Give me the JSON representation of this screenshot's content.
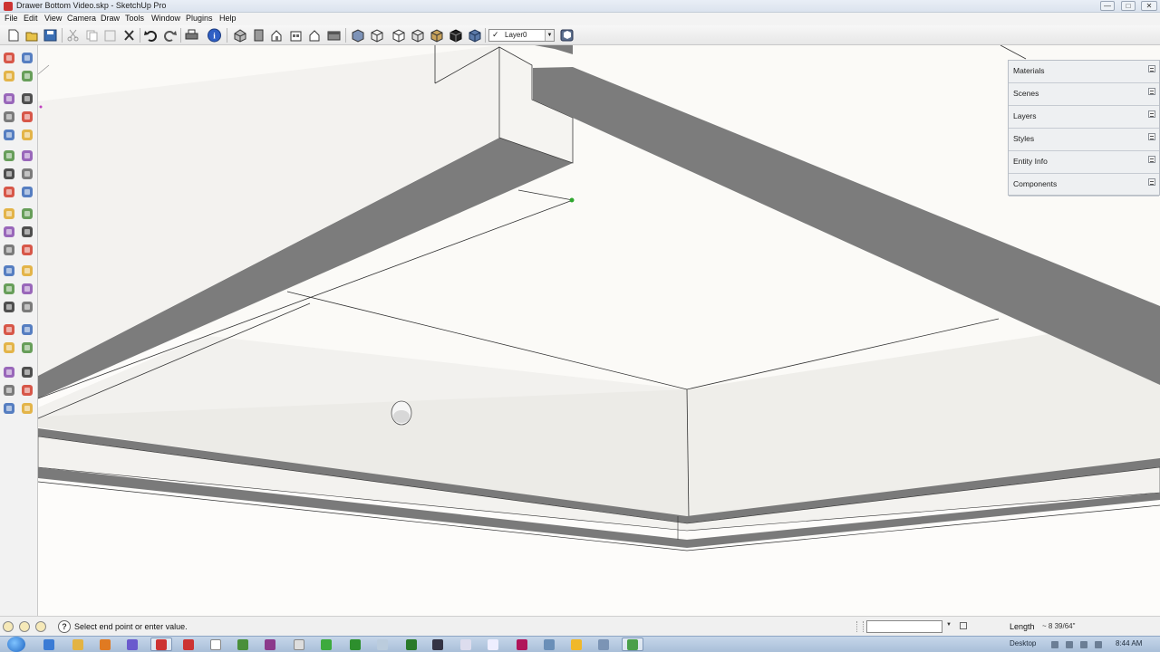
{
  "window": {
    "title": "Drawer Bottom Video.skp - SketchUp Pro",
    "controls": [
      "—",
      "□",
      "✕"
    ]
  },
  "menu": [
    "File",
    "Edit",
    "View",
    "Camera",
    "Draw",
    "Tools",
    "Window",
    "Plugins",
    "Help"
  ],
  "toolbar": {
    "layer_selected": "Layer0",
    "layer_checked": "✓",
    "buttons": [
      "new-icon",
      "open-icon",
      "save-icon",
      "cut-icon",
      "copy-icon",
      "paste-icon",
      "erase-icon",
      "undo-icon",
      "redo-icon",
      "print-icon",
      "model-info-icon",
      "iso-view-icon",
      "top-view-icon",
      "front-view-icon",
      "right-view-icon",
      "back-view-icon",
      "left-view-icon",
      "xray-icon",
      "wireframe-icon",
      "hidden-line-icon",
      "shaded-icon",
      "shaded-textures-icon",
      "monochrome-icon",
      "layer-manager-icon"
    ]
  },
  "palette": {
    "tools": [
      "select-icon",
      "make-component-icon",
      "paint-bucket-icon",
      "eraser-icon",
      "rectangle-icon",
      "line-icon",
      "circle-icon",
      "arc-icon",
      "polygon-icon",
      "freehand-icon",
      "move-icon",
      "push-pull-icon",
      "rotate-icon",
      "follow-me-icon",
      "scale-icon",
      "offset-icon",
      "tape-measure-icon",
      "dimension-icon",
      "protractor-icon",
      "text-icon",
      "axes-icon",
      "3d-text-icon",
      "orbit-icon",
      "pan-icon",
      "zoom-icon",
      "zoom-window-icon",
      "zoom-extents-icon",
      "previous-view-icon",
      "position-camera-icon",
      "look-around-icon",
      "walk-icon",
      "section-plane-icon",
      "sandbox-icon",
      "warehouse-icon",
      "share-model-icon",
      "get-components-icon",
      "share-component-icon",
      "extension-icon"
    ]
  },
  "tray": {
    "items": [
      "Materials",
      "Scenes",
      "Layers",
      "Styles",
      "Entity Info",
      "Components"
    ]
  },
  "status": {
    "hint": "Select end point or enter value.",
    "help": "?",
    "vcb_value": "",
    "length_label": "Length",
    "length_value": "~ 8 39/64\""
  },
  "taskbar": {
    "desktop_label": "Desktop",
    "clock": "8:44 AM"
  },
  "colors": {
    "face_dark": "#7d7d7d",
    "face_light": "#f0efec",
    "edge": "#2b2b2b",
    "inference_green": "#2fa62f"
  }
}
